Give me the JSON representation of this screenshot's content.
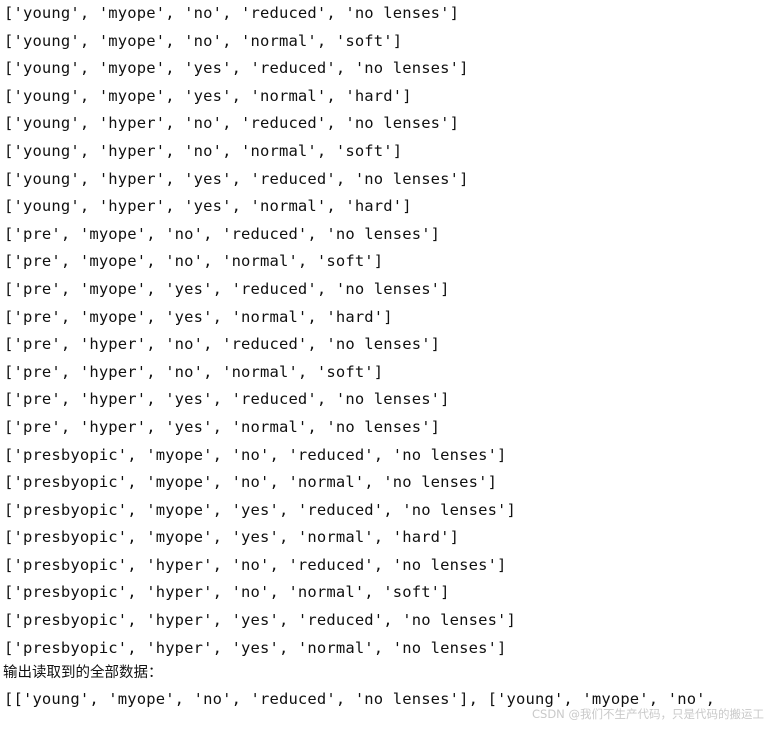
{
  "console": {
    "background_color": "#ffffff",
    "text_color": "#101010",
    "lines": [
      "['young', 'myope', 'no', 'reduced', 'no lenses']",
      "['young', 'myope', 'no', 'normal', 'soft']",
      "['young', 'myope', 'yes', 'reduced', 'no lenses']",
      "['young', 'myope', 'yes', 'normal', 'hard']",
      "['young', 'hyper', 'no', 'reduced', 'no lenses']",
      "['young', 'hyper', 'no', 'normal', 'soft']",
      "['young', 'hyper', 'yes', 'reduced', 'no lenses']",
      "['young', 'hyper', 'yes', 'normal', 'hard']",
      "['pre', 'myope', 'no', 'reduced', 'no lenses']",
      "['pre', 'myope', 'no', 'normal', 'soft']",
      "['pre', 'myope', 'yes', 'reduced', 'no lenses']",
      "['pre', 'myope', 'yes', 'normal', 'hard']",
      "['pre', 'hyper', 'no', 'reduced', 'no lenses']",
      "['pre', 'hyper', 'no', 'normal', 'soft']",
      "['pre', 'hyper', 'yes', 'reduced', 'no lenses']",
      "['pre', 'hyper', 'yes', 'normal', 'no lenses']",
      "['presbyopic', 'myope', 'no', 'reduced', 'no lenses']",
      "['presbyopic', 'myope', 'no', 'normal', 'no lenses']",
      "['presbyopic', 'myope', 'yes', 'reduced', 'no lenses']",
      "['presbyopic', 'myope', 'yes', 'normal', 'hard']",
      "['presbyopic', 'hyper', 'no', 'reduced', 'no lenses']",
      "['presbyopic', 'hyper', 'no', 'normal', 'soft']",
      "['presbyopic', 'hyper', 'yes', 'reduced', 'no lenses']",
      "['presbyopic', 'hyper', 'yes', 'normal', 'no lenses']"
    ],
    "label": "输出读取到的全部数据：",
    "final_line": "[['young', 'myope', 'no', 'reduced', 'no lenses'], ['young', 'myope', 'no',"
  },
  "watermark": {
    "text": "CSDN @我们不生产代码，只是代码的搬运工",
    "color": "#c9c9c9"
  }
}
